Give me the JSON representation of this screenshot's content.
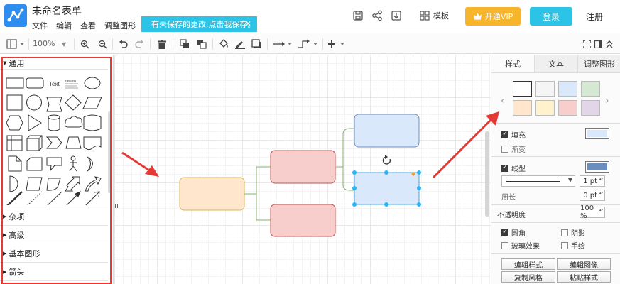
{
  "header": {
    "title": "未命名表单",
    "menu": [
      "文件",
      "编辑",
      "查看",
      "调整图形"
    ],
    "unsaved_banner": "有未保存的更改,点击我保存。",
    "banner_close": "✕",
    "template_label": "模板",
    "vip_label": "开通VIP",
    "login_label": "登录",
    "register_label": "注册"
  },
  "toolbar": {
    "zoom": "100%"
  },
  "left_panel": {
    "sections": [
      "通用",
      "杂项",
      "高级",
      "基本图形",
      "箭头"
    ],
    "text_shape_label": "Text",
    "heading_shape_label": "Heading"
  },
  "right_panel": {
    "tabs": [
      "样式",
      "文本",
      "调整图形"
    ],
    "swatches": [
      "#ffffff",
      "#f5f5f5",
      "#dae8fc",
      "#d5e8d4",
      "#ffe6cc",
      "#fff2cc",
      "#f8cecc",
      "#e1d5e7"
    ],
    "fill_label": "填充",
    "fill_color": "#dae8fc",
    "gradient_label": "渐变",
    "line_label": "线型",
    "line_color": "#6c8ebf",
    "line_width": "1 pt",
    "perimeter_label": "周长",
    "perimeter_value": "0 pt",
    "opacity_label": "不透明度",
    "opacity_value": "100 %",
    "rounded_label": "圆角",
    "shadow_label": "阴影",
    "glass_label": "玻璃效果",
    "sketch_label": "手绘",
    "edit_style": "编辑样式",
    "edit_image": "编辑图像",
    "copy_style": "复制风格",
    "paste_style": "粘贴样式"
  },
  "colors": {
    "accent": "#2bc4e6",
    "vip": "#f7b52b",
    "annotation": "#e53935",
    "orange_fill": "#ffe6cc",
    "orange_stroke": "#d6b656",
    "red_fill": "#f8cecc",
    "red_stroke": "#b85450",
    "blue_fill": "#dae8fc",
    "blue_stroke": "#6c8ebf",
    "connector": "#82b366",
    "selection": "#29b6f6"
  }
}
